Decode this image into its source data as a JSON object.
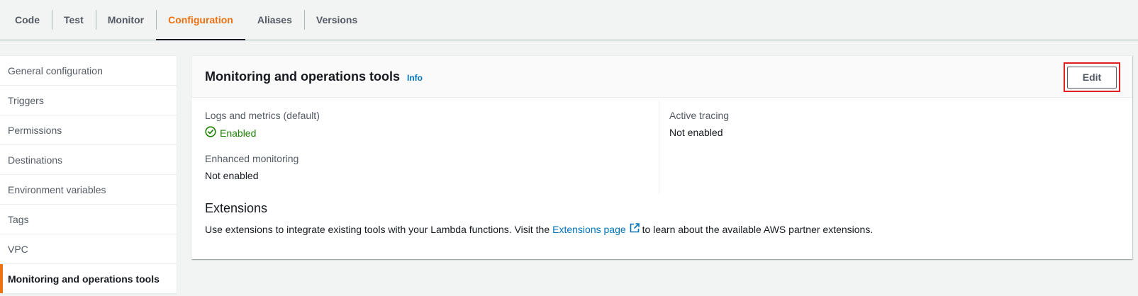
{
  "tabs": [
    {
      "label": "Code"
    },
    {
      "label": "Test"
    },
    {
      "label": "Monitor"
    },
    {
      "label": "Configuration",
      "active": true
    },
    {
      "label": "Aliases"
    },
    {
      "label": "Versions"
    }
  ],
  "sidebar": {
    "items": [
      {
        "label": "General configuration"
      },
      {
        "label": "Triggers"
      },
      {
        "label": "Permissions"
      },
      {
        "label": "Destinations"
      },
      {
        "label": "Environment variables"
      },
      {
        "label": "Tags"
      },
      {
        "label": "VPC"
      },
      {
        "label": "Monitoring and operations tools",
        "active": true
      }
    ]
  },
  "panel": {
    "title": "Monitoring and operations tools",
    "info_label": "Info",
    "edit_label": "Edit",
    "logs": {
      "label": "Logs and metrics (default)",
      "value": "Enabled",
      "status": "success-icon"
    },
    "enhanced": {
      "label": "Enhanced monitoring",
      "value": "Not enabled"
    },
    "tracing": {
      "label": "Active tracing",
      "value": "Not enabled"
    },
    "extensions": {
      "title": "Extensions",
      "desc_before": "Use extensions to integrate existing tools with your Lambda functions. Visit the",
      "link_label": "Extensions page",
      "desc_after": "to learn about the available AWS partner extensions."
    }
  },
  "colors": {
    "accent": "#ec7211",
    "link": "#0073bb",
    "success": "#1d8102",
    "highlight": "#e02020"
  }
}
